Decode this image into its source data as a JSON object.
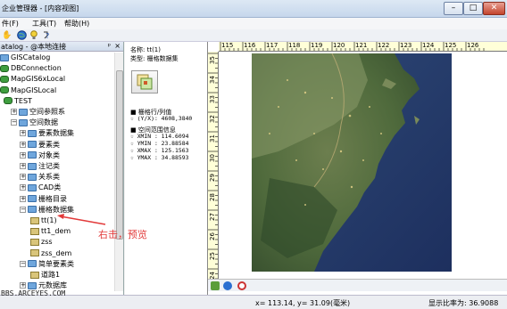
{
  "window": {
    "title": "企业管理器 - [内容视图]",
    "min_glyph": "–",
    "max_glyph": "□",
    "close_glyph": "✕"
  },
  "menu": {
    "items": [
      "件(F)",
      "工具(T)",
      "帮助(H)"
    ]
  },
  "toolbar": {
    "items": [
      "hand-icon",
      "globe-icon",
      "bulb-icon",
      "help-icon"
    ]
  },
  "catalog": {
    "header": "atalog - @本地连接",
    "pin_glyph": "ᵖ",
    "close_glyph": "×",
    "tree": [
      {
        "label": "GISCatalog",
        "indent": 0,
        "icon": "folder"
      },
      {
        "label": "DBConnection",
        "indent": 0,
        "icon": "db"
      },
      {
        "label": "MapGIS6xLocal",
        "indent": 0,
        "icon": "db"
      },
      {
        "label": "MapGISLocal",
        "indent": 0,
        "icon": "db"
      },
      {
        "label": "TEST",
        "indent": 1,
        "icon": "db"
      },
      {
        "label": "空间参照系",
        "indent": 2,
        "icon": "folder"
      },
      {
        "label": "空间数据",
        "indent": 2,
        "icon": "folder"
      },
      {
        "label": "要素数据集",
        "indent": 3,
        "icon": "folder"
      },
      {
        "label": "要素类",
        "indent": 3,
        "icon": "folder"
      },
      {
        "label": "对象类",
        "indent": 3,
        "icon": "folder"
      },
      {
        "label": "注记类",
        "indent": 3,
        "icon": "folder"
      },
      {
        "label": "关系类",
        "indent": 3,
        "icon": "folder"
      },
      {
        "label": "CAD类",
        "indent": 3,
        "icon": "folder"
      },
      {
        "label": "栅格目录",
        "indent": 3,
        "icon": "folder"
      },
      {
        "label": "栅格数据集",
        "indent": 3,
        "icon": "folder"
      },
      {
        "label": "tt(1)",
        "indent": 4,
        "icon": "pt"
      },
      {
        "label": "tt1_dem",
        "indent": 4,
        "icon": "pt"
      },
      {
        "label": "zss",
        "indent": 4,
        "icon": "pt"
      },
      {
        "label": "zss_dem",
        "indent": 4,
        "icon": "pt"
      },
      {
        "label": "简单要素类",
        "indent": 3,
        "icon": "folder"
      },
      {
        "label": "道路1",
        "indent": 4,
        "icon": "pt"
      },
      {
        "label": "元数据库",
        "indent": 3,
        "icon": "folder"
      }
    ]
  },
  "props": {
    "name": "名称: tt(1)",
    "type": "类型: 栅格数据集",
    "section1": "栅格行/列值",
    "rowcol": "(Y/X): 4608,3840",
    "section2": "空间范围信息",
    "xmin": "XMIN : 114.6094",
    "ymin": "YMIN : 23.88584",
    "xmax": "XMAX : 125.1563",
    "ymax": "YMAX : 34.88593"
  },
  "ruler": {
    "top": [
      "115",
      "116",
      "117",
      "118",
      "119",
      "120",
      "121",
      "122",
      "123",
      "124",
      "125",
      "126"
    ],
    "left": [
      "35",
      "34",
      "33",
      "32",
      "31",
      "30",
      "29",
      "28",
      "27",
      "26",
      "25",
      "24"
    ]
  },
  "annotation": "右击，预览",
  "status": {
    "coords": "x= 113.14, y= 31.09(毫米)",
    "scale": "显示比率为: 36.9088"
  },
  "watermark": "BBS.ARCEYES.COM",
  "colors": {
    "annotation": "#e23a3a",
    "ruler_bg": "#ffffd8",
    "accent": "#c6d7ec"
  }
}
